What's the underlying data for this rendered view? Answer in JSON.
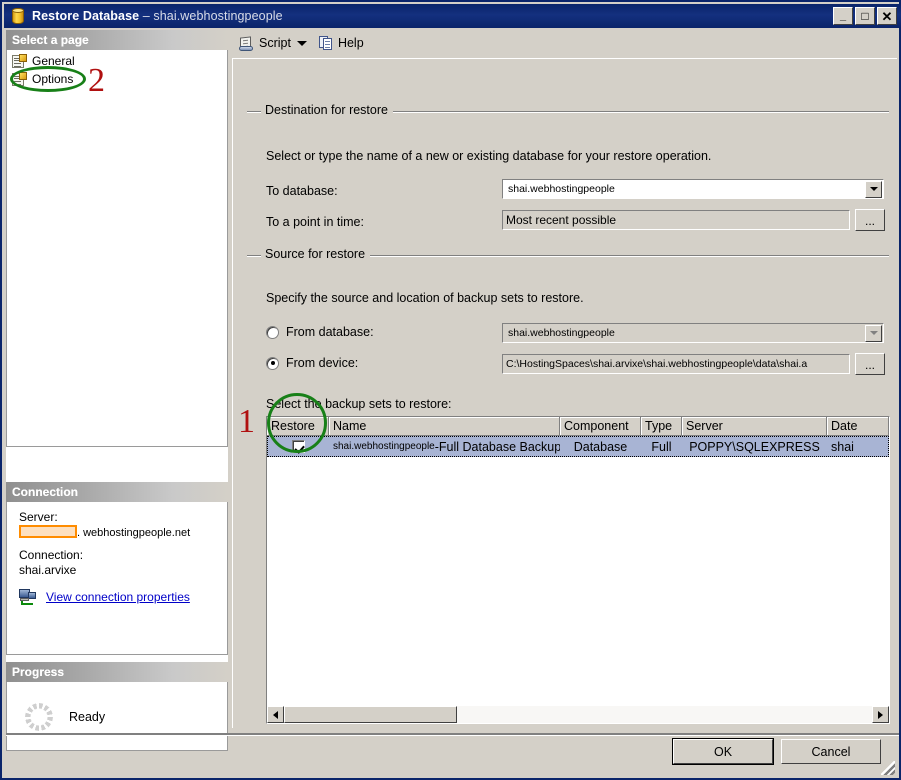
{
  "window": {
    "title": "Restore Database",
    "subtitle": "– shai.webhostingpeople",
    "icon": "database-icon",
    "minimize": "_",
    "maximize": "□",
    "close": "✕"
  },
  "sidebar": {
    "select_page_header": "Select a page",
    "pages": [
      {
        "label": "General",
        "icon": "page-icon"
      },
      {
        "label": "Options",
        "icon": "page-icon"
      }
    ],
    "connection": {
      "header": "Connection",
      "server_label": "Server:",
      "server_value_redacted": "",
      "server_value_suffix": ". webhostingpeople.net",
      "connection_label": "Connection:",
      "connection_value": "shai.arvixe",
      "link": "View connection properties",
      "link_icon": "network-connection-icon"
    },
    "progress": {
      "header": "Progress",
      "status": "Ready",
      "icon": "spinner-icon"
    }
  },
  "toolbar": {
    "script_label": "Script",
    "script_icon": "script-icon",
    "dropdown_icon": "chevron-down-icon",
    "help_label": "Help",
    "help_icon": "help-icon"
  },
  "destination_group": {
    "title": "Destination for restore",
    "hint": "Select or type the name of a new or existing database for your restore operation.",
    "to_database_label": "To database:",
    "to_database_value": "shai.webhostingpeople",
    "to_point_in_time_label": "To a point in time:",
    "to_point_in_time_value": "Most recent possible",
    "browse_button": "..."
  },
  "source_group": {
    "title": "Source for restore",
    "hint": "Specify the source and location of backup sets to restore.",
    "from_database_label": "From database:",
    "from_database_value": "shai.webhostingpeople",
    "from_database_selected": false,
    "from_device_label": "From device:",
    "from_device_value": "C:\\HostingSpaces\\shai.arvixe\\shai.webhostingpeople\\data\\shai.a",
    "from_device_selected": true,
    "browse_button": "...",
    "backup_sets_label": "Select the backup sets to restore:"
  },
  "backup_grid": {
    "columns": [
      "Restore",
      "Name",
      "Component",
      "Type",
      "Server",
      "Date"
    ],
    "rows": [
      {
        "restore_checked": true,
        "name_prefix": "shai.webhostingpeople",
        "name_suffix": "-Full Database Backup",
        "component": "Database",
        "type": "Full",
        "server": "POPPY\\SQLEXPRESS",
        "date": "shai"
      }
    ],
    "scrollbar": {
      "left_arrow": "◄",
      "right_arrow": "►"
    }
  },
  "footer": {
    "ok": "OK",
    "cancel": "Cancel"
  },
  "annotations": [
    {
      "number": "1",
      "target": "restore-checkbox"
    },
    {
      "number": "2",
      "target": "sidebar-item-options"
    }
  ],
  "colors": {
    "titlebar": "#0a246a",
    "dialog_face": "#d4d0c8",
    "selected_row": "#a8b4d4",
    "link": "#0000c8",
    "annotation_circle": "#188018",
    "annotation_number": "#b01010",
    "redaction": "#ff8c00"
  }
}
